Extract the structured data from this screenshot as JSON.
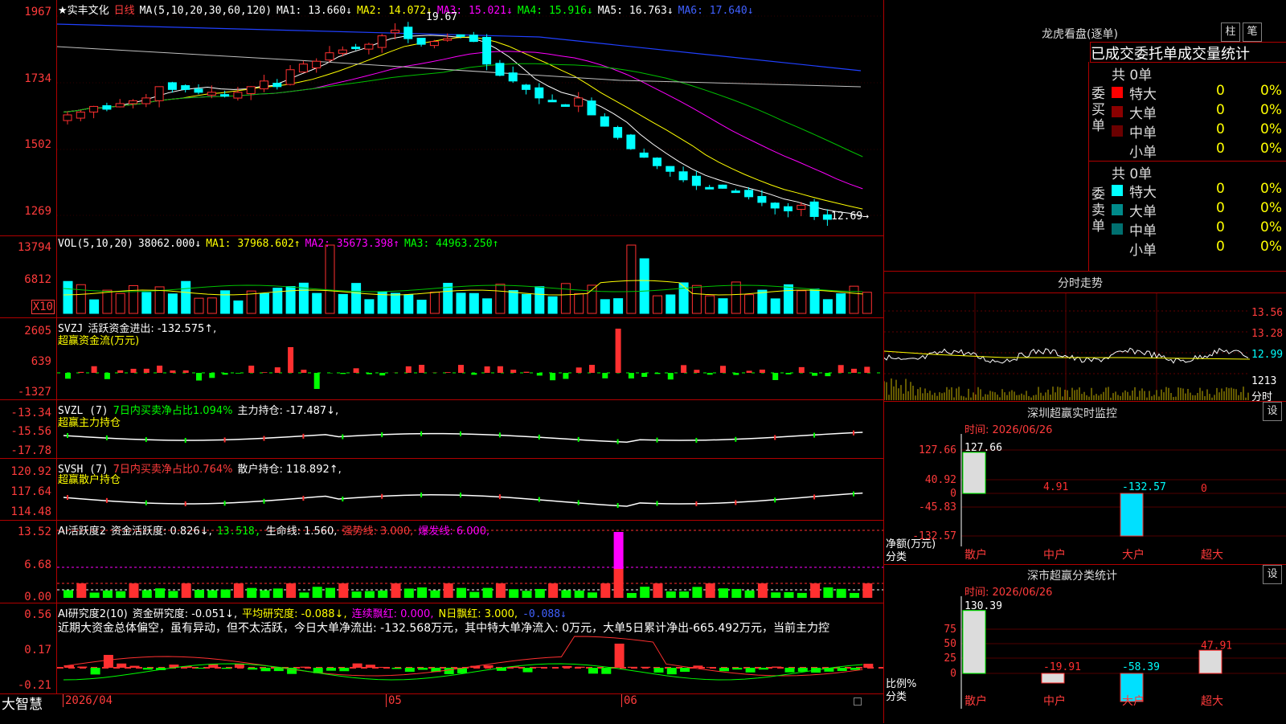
{
  "stock": {
    "name": "★实丰文化",
    "period": "日线"
  },
  "main_pane": {
    "ma_header": "MA(5,10,20,30,60,120)",
    "ma1": "MA1: 13.660↓",
    "ma2": "MA2: 14.072↓",
    "ma3": "MA3: 15.021↓",
    "ma4": "MA4: 15.916↓",
    "ma5": "MA5: 16.763↓",
    "ma6": "MA6: 17.640↓",
    "ticks": [
      "1967",
      "1734",
      "1502",
      "1269"
    ],
    "high_label": "19.67",
    "low_label": "12.69→"
  },
  "vol_pane": {
    "title": "VOL(5,10,20)",
    "value": "38062.000↓",
    "ma1": "MA1: 37968.602↑",
    "ma2": "MA2: 35673.398↑",
    "ma3": "MA3: 44963.250↑",
    "ticks": [
      "13794",
      "6812"
    ],
    "unit": "X10"
  },
  "svzj_pane": {
    "title": "SVZJ",
    "desc": "活跃资金进出: -132.575↑,",
    "subtitle": "超赢资金流(万元)",
    "ticks": [
      "2605",
      "639",
      "-1327"
    ]
  },
  "svzl_pane": {
    "title": "SVZL (7)",
    "desc1": "7日内买卖净占比1.094%",
    "desc2": "主力持仓: -17.487↓,",
    "subtitle": "超赢主力持仓",
    "ticks": [
      "-13.34",
      "-15.56",
      "-17.78"
    ]
  },
  "svsh_pane": {
    "title": "SVSH (7)",
    "desc1": "7日内买卖净占比0.764%",
    "desc2": "散户持仓: 118.892↑,",
    "subtitle": "超赢散户持仓",
    "ticks": [
      "120.92",
      "117.64",
      "114.48"
    ]
  },
  "ai_active": {
    "title": "AI活跃度2",
    "v1": "资金活跃度: 0.826↓,",
    "v2": "13.518,",
    "v3": "生命线: 1.560,",
    "v4": "强势线: 3.000,",
    "v5": "爆发线: 6.000,",
    "ticks": [
      "13.52",
      "6.68",
      "0.00"
    ]
  },
  "ai_research": {
    "title": "AI研究度2(10)",
    "v1": "资金研究度: -0.051↓,",
    "v2": "平均研究度: -0.088↓,",
    "v3": "连续飘红: 0.000,",
    "v4": "N日飘红: 3.000,",
    "v5": "-0.088↓",
    "comment": "近期大资金总体偏空，虽有异动，但不太活跃，今日大单净流出: -132.568万元，其中特大单净流入: 0万元，大单5日累计净出-665.492万元，当前主力控",
    "ticks": [
      "0.56",
      "0.17",
      "-0.21"
    ]
  },
  "bottom_bar": {
    "brand": "大智慧",
    "date": "2026/04",
    "m5": "05",
    "m6": "06"
  },
  "dragon": {
    "title": "龙虎看盘(逐单)",
    "btn1": "柱",
    "btn2": "笔",
    "tab": "已成交委托单成交量统计",
    "buy": {
      "label": "委买单",
      "total": "共 0单",
      "rows": [
        {
          "name": "特大",
          "val": "0",
          "pct": "0%",
          "color": "#ff0000"
        },
        {
          "name": "大单",
          "val": "0",
          "pct": "0%",
          "color": "#8b0000"
        },
        {
          "name": "中单",
          "val": "0",
          "pct": "0%",
          "color": "#6b0000"
        },
        {
          "name": "小单",
          "val": "0",
          "pct": "0%",
          "color": "#000000"
        }
      ]
    },
    "sell": {
      "label": "委卖单",
      "total": "共 0单",
      "rows": [
        {
          "name": "特大",
          "val": "0",
          "pct": "0%",
          "color": "#00ffff"
        },
        {
          "name": "大单",
          "val": "0",
          "pct": "0%",
          "color": "#008b8b"
        },
        {
          "name": "中单",
          "val": "0",
          "pct": "0%",
          "color": "#007070"
        },
        {
          "name": "小单",
          "val": "0",
          "pct": "0%",
          "color": "#000000"
        }
      ]
    }
  },
  "intraday": {
    "title": "分时走势",
    "ticks": [
      "13.56",
      "13.28",
      "12.99"
    ],
    "vol_tick": "1213",
    "vol_label": "分时"
  },
  "monitor": {
    "title": "深圳超赢实时监控",
    "btn": "设",
    "time": "时间: 2026/06/26",
    "ticks": [
      "127.66",
      "40.92",
      "0",
      "-45.83",
      "-132.57"
    ],
    "y_label1": "净额(万元)",
    "y_label2": "分类",
    "chart_data": {
      "type": "bar",
      "categories": [
        "散户",
        "中户",
        "大户",
        "超大"
      ],
      "values": [
        127.66,
        4.91,
        -132.57,
        0
      ],
      "labels": [
        "127.66",
        "4.91",
        "-132.57",
        "0"
      ]
    }
  },
  "classify": {
    "title": "深市超赢分类统计",
    "btn": "设",
    "time": "时间: 2026/06/26",
    "ticks": [
      "75",
      "50",
      "25",
      "0"
    ],
    "y_label1": "比例%",
    "y_label2": "分类",
    "chart_data": {
      "type": "bar",
      "categories": [
        "散户",
        "中户",
        "大户",
        "超大"
      ],
      "values": [
        130.39,
        -19.91,
        -58.39,
        47.91
      ],
      "labels": [
        "130.39",
        "-19.91",
        "-58.39",
        "47.91"
      ]
    }
  }
}
